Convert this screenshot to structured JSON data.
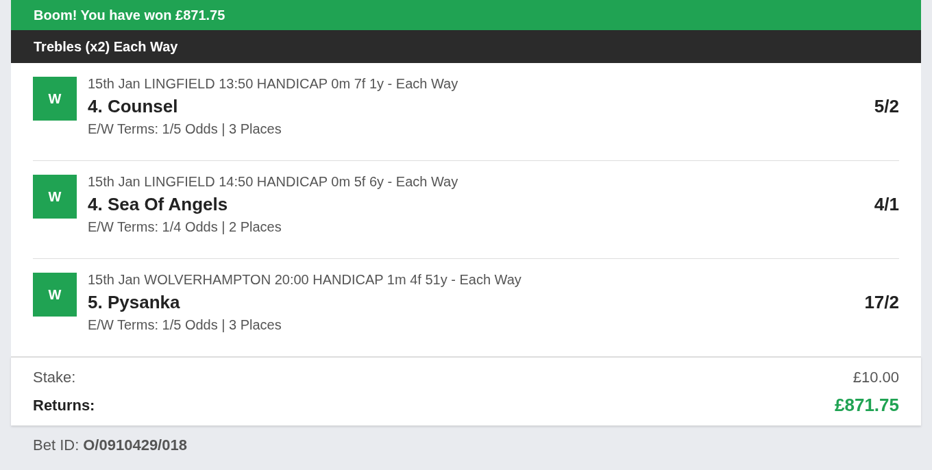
{
  "banner": {
    "text": "Boom! You have won £871.75"
  },
  "bet_type": {
    "title": "Trebles (x2) Each Way"
  },
  "selections": [
    {
      "result": "W",
      "race": "15th Jan LINGFIELD 13:50 HANDICAP 0m 7f 1y - Each Way",
      "horse": "4. Counsel",
      "odds": "5/2",
      "terms": "E/W Terms: 1/5 Odds | 3 Places"
    },
    {
      "result": "W",
      "race": "15th Jan LINGFIELD 14:50 HANDICAP 0m 5f 6y - Each Way",
      "horse": "4. Sea Of Angels",
      "odds": "4/1",
      "terms": "E/W Terms: 1/4 Odds | 2 Places"
    },
    {
      "result": "W",
      "race": "15th Jan WOLVERHAMPTON 20:00 HANDICAP 1m 4f 51y - Each Way",
      "horse": "5. Pysanka",
      "odds": "17/2",
      "terms": "E/W Terms: 1/5 Odds | 3 Places"
    }
  ],
  "summary": {
    "stake_label": "Stake:",
    "stake": "£10.00",
    "returns_label": "Returns:",
    "returns": "£871.75"
  },
  "footer": {
    "bet_id_label": "Bet ID:",
    "bet_id": "O/0910429/018"
  }
}
